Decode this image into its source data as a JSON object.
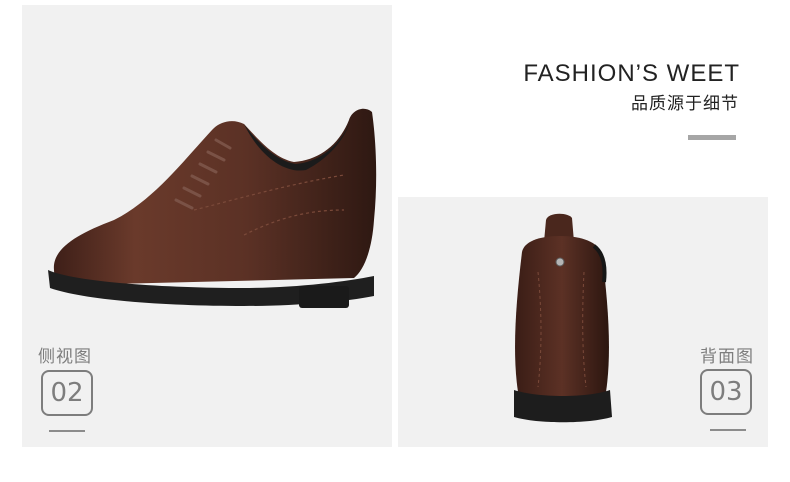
{
  "header": {
    "title": "FASHION’S WEET",
    "subtitle": "品质源于细节"
  },
  "views": {
    "side": {
      "label": "侧视图",
      "number": "02"
    },
    "back": {
      "label": "背面图",
      "number": "03"
    }
  },
  "colors": {
    "panel": "#f1f1f1",
    "leather": "#5e3326",
    "sole": "#222222",
    "accent_gray": "#a6a6a6",
    "label_gray": "#7d7d7d"
  }
}
